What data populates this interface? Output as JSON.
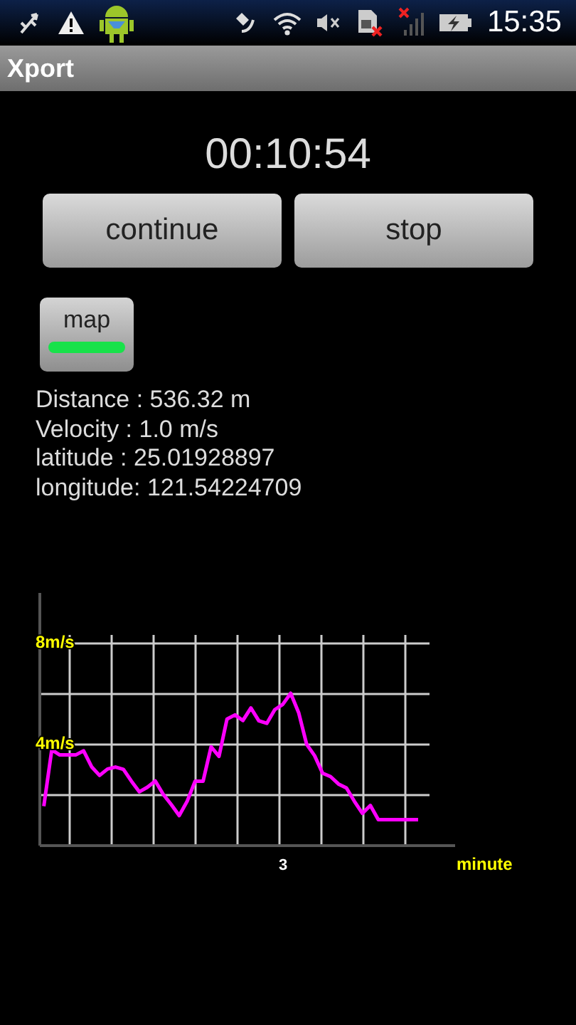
{
  "status_bar": {
    "time": "15:35"
  },
  "window": {
    "title": "Xport"
  },
  "timer": "00:10:54",
  "buttons": [
    {
      "label": "continue"
    },
    {
      "label": "stop"
    }
  ],
  "map_toggle": {
    "label": "map",
    "on": true
  },
  "readings": [
    "Distance : 536.32 m",
    "Velocity : 1.0 m/s",
    "latitude : 25.01928897",
    "longitude: 121.54224709"
  ],
  "chart": {
    "chart_data": {
      "type": "line",
      "xlabel": "minute",
      "ylim": [
        0,
        10
      ],
      "grid": true,
      "annotations": [
        "3"
      ],
      "yticks": [
        {
          "value": 4,
          "label": "4m/s"
        },
        {
          "value": 8,
          "label": "8m/s"
        }
      ],
      "series": [
        {
          "color": "#ff00ff",
          "values": [
            1.56,
            3.79,
            3.59,
            3.59,
            3.59,
            3.75,
            3.12,
            2.78,
            3.03,
            3.11,
            3.02,
            2.55,
            2.13,
            2.31,
            2.56,
            2.03,
            1.63,
            1.19,
            1.76,
            2.55,
            2.55,
            3.91,
            3.53,
            5.01,
            5.17,
            4.95,
            5.45,
            4.94,
            4.84,
            5.38,
            5.59,
            6.03,
            5.26,
            4.01,
            3.56,
            2.87,
            2.73,
            2.44,
            2.28,
            1.75,
            1.28,
            1.59,
            1.03,
            1.03,
            1.03,
            1.03,
            1.03,
            1.03
          ]
        }
      ]
    }
  }
}
